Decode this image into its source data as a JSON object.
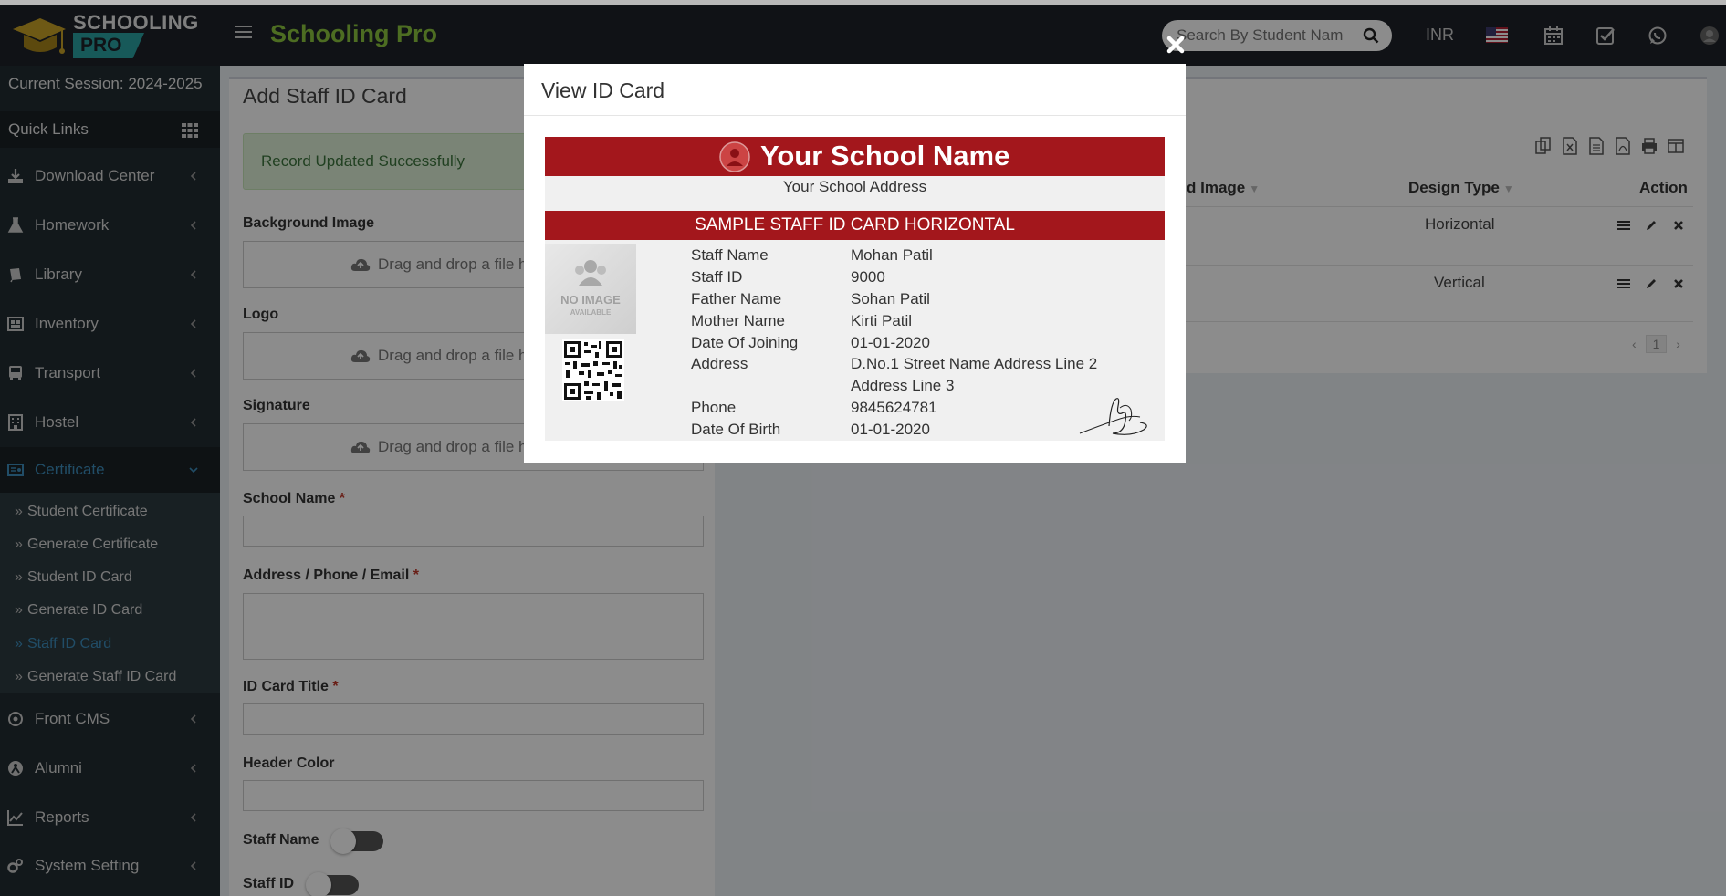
{
  "app": {
    "logo_line1": "SCHOOLING",
    "logo_line2": "PRO",
    "title": "Schooling Pro",
    "brand_color": "#8cc63f",
    "accent": "#3c8dbc"
  },
  "topbar": {
    "search_placeholder": "Search By Student Nam",
    "currency": "INR"
  },
  "sidebar": {
    "session": "Current Session: 2024-2025",
    "quick_links": "Quick Links",
    "items": [
      {
        "label": "Download Center",
        "icon": "download-icon"
      },
      {
        "label": "Homework",
        "icon": "flask-icon"
      },
      {
        "label": "Library",
        "icon": "book-icon"
      },
      {
        "label": "Inventory",
        "icon": "inventory-icon"
      },
      {
        "label": "Transport",
        "icon": "bus-icon"
      },
      {
        "label": "Hostel",
        "icon": "building-icon"
      },
      {
        "label": "Certificate",
        "icon": "certificate-icon"
      },
      {
        "label": "Front CMS",
        "icon": "cms-icon"
      },
      {
        "label": "Alumni",
        "icon": "alumni-icon"
      },
      {
        "label": "Reports",
        "icon": "chart-icon"
      },
      {
        "label": "System Setting",
        "icon": "gears-icon"
      }
    ],
    "sub_items": [
      "Student Certificate",
      "Generate Certificate",
      "Student ID Card",
      "Generate ID Card",
      "Staff ID Card",
      "Generate Staff ID Card"
    ]
  },
  "form": {
    "title": "Add Staff ID Card",
    "alert": "Record Updated Successfully",
    "background_image": "Background Image",
    "logo": "Logo",
    "signature": "Signature",
    "dropzone_text": "Drag and drop a file h",
    "school_name": "School Name",
    "address": "Address / Phone / Email",
    "id_card_title": "ID Card Title",
    "header_color": "Header Color",
    "staff_name": "Staff Name",
    "staff_id": "Staff ID",
    "required_mark": "*"
  },
  "table": {
    "col_image": "d Image",
    "col_design": "Design Type",
    "col_action": "Action",
    "rows": [
      {
        "design": "Horizontal"
      },
      {
        "design": "Vertical"
      }
    ],
    "page": "1",
    "prev": "‹",
    "next": "›"
  },
  "modal": {
    "title": "View ID Card",
    "card": {
      "school_name": "Your School Name",
      "school_address": "Your School Address",
      "card_title": "SAMPLE STAFF ID CARD HORIZONTAL",
      "header_color": "#a3171c",
      "no_image_1": "NO IMAGE",
      "no_image_2": "AVAILABLE",
      "fields": [
        {
          "label": "Staff Name",
          "value": "Mohan Patil"
        },
        {
          "label": "Staff ID",
          "value": "9000"
        },
        {
          "label": "Father Name",
          "value": "Sohan Patil"
        },
        {
          "label": "Mother Name",
          "value": "Kirti Patil"
        },
        {
          "label": "Date Of Joining",
          "value": "01-01-2020"
        },
        {
          "label": "Address",
          "value": "D.No.1 Street Name Address Line 2"
        },
        {
          "label": "",
          "value": "Address Line 3"
        },
        {
          "label": "Phone",
          "value": "9845624781"
        },
        {
          "label": "Date Of Birth",
          "value": "01-01-2020"
        }
      ]
    }
  }
}
